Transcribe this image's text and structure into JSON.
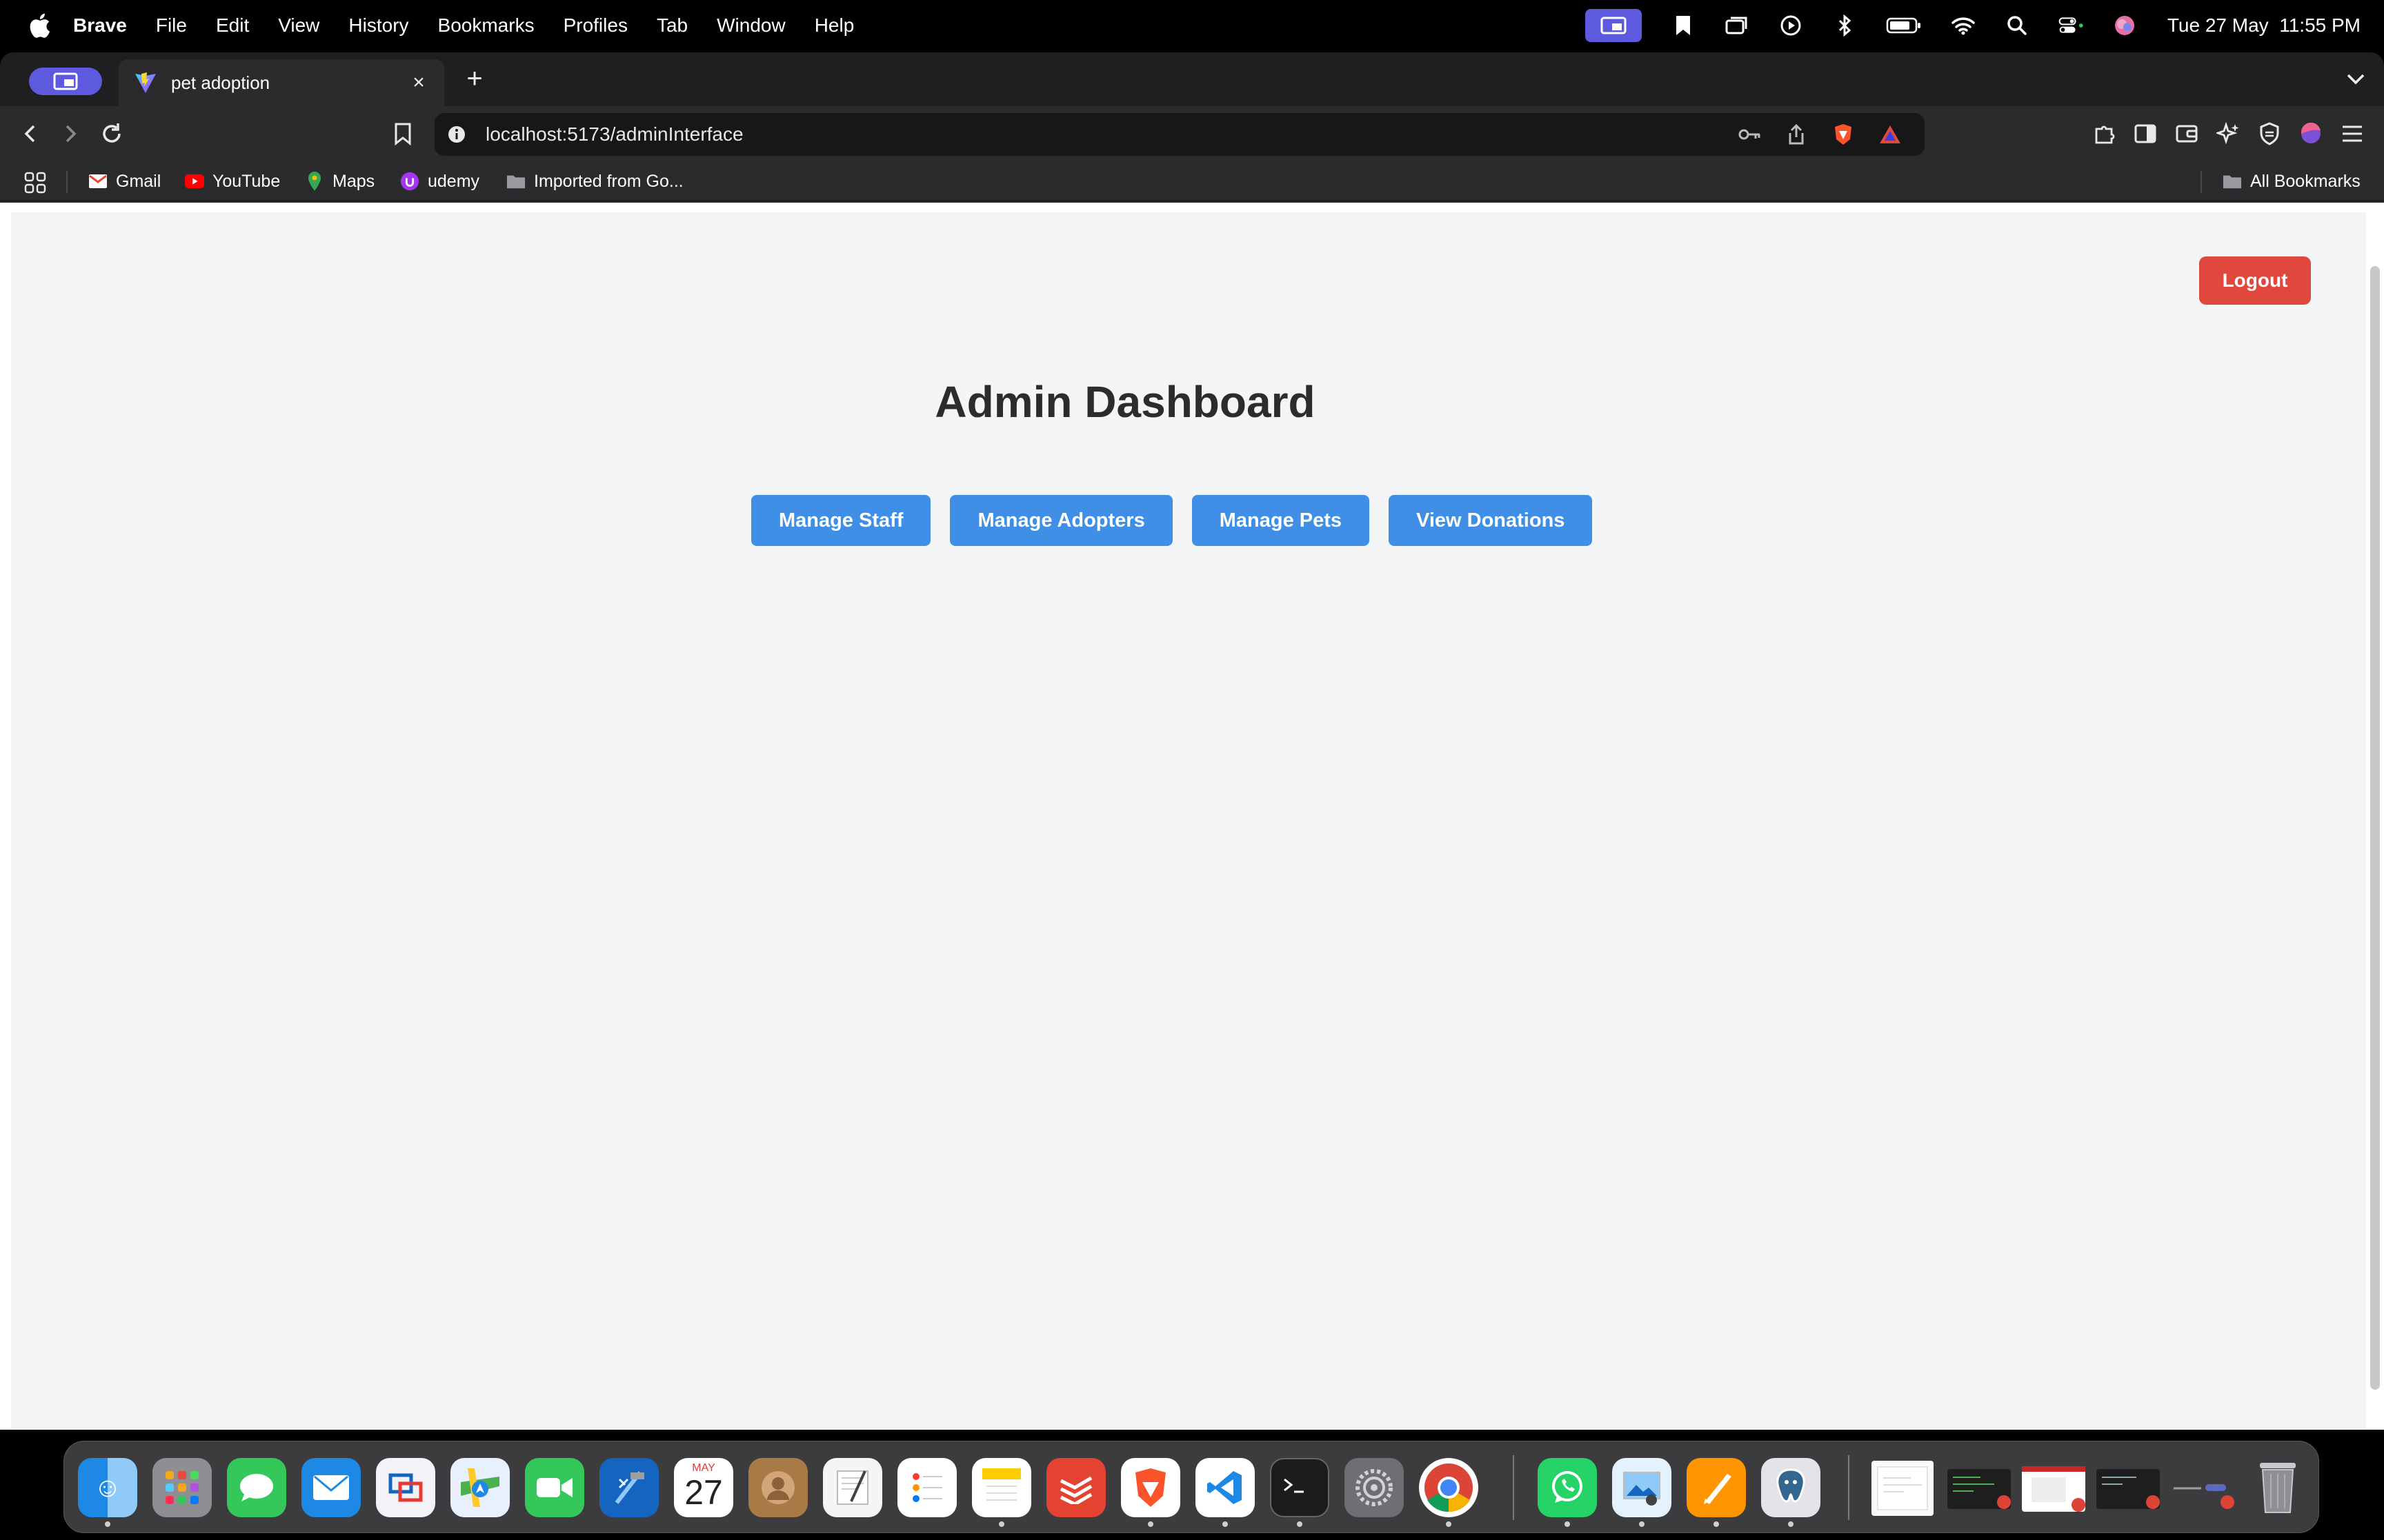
{
  "menubar": {
    "app_name": "Brave",
    "menus": [
      "File",
      "Edit",
      "View",
      "History",
      "Bookmarks",
      "Profiles",
      "Tab",
      "Window",
      "Help"
    ],
    "datetime": "Tue 27 May  11:55 PM"
  },
  "browser": {
    "tab_title": "pet adoption",
    "url": "localhost:5173/adminInterface",
    "bookmarks": [
      {
        "label": "Gmail",
        "icon": "gmail-icon"
      },
      {
        "label": "YouTube",
        "icon": "youtube-icon"
      },
      {
        "label": "Maps",
        "icon": "maps-icon"
      },
      {
        "label": "udemy",
        "icon": "udemy-icon"
      },
      {
        "label": "Imported from Go...",
        "icon": "folder-icon"
      }
    ],
    "all_bookmarks": "All Bookmarks"
  },
  "page": {
    "title": "Admin Dashboard",
    "logout_label": "Logout",
    "actions": [
      "Manage Staff",
      "Manage Adopters",
      "Manage Pets",
      "View Donations"
    ]
  },
  "dock": {
    "calendar_month": "MAY",
    "calendar_day": "27"
  },
  "colors": {
    "primary_button": "#3f8fe6",
    "logout_button": "#e0483d",
    "page_background": "#f4f5f7",
    "title_text": "#2c2c2c"
  }
}
